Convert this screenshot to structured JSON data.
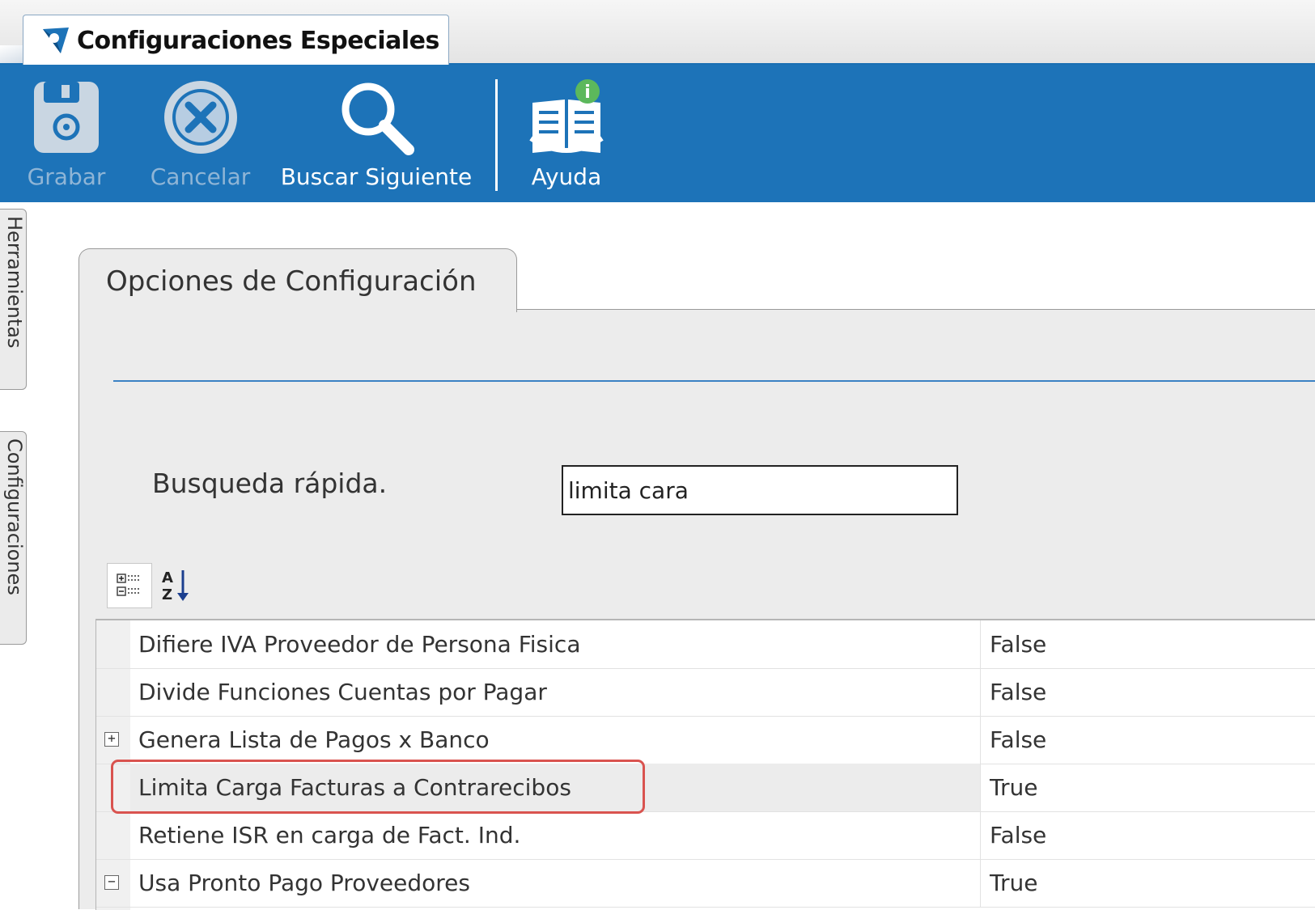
{
  "window": {
    "tab_title": "Configuraciones Especiales"
  },
  "toolbar": {
    "items": [
      {
        "label": "Grabar",
        "icon": "save-icon",
        "enabled": false
      },
      {
        "label": "Cancelar",
        "icon": "cancel-icon",
        "enabled": false
      },
      {
        "label": "Buscar Siguiente",
        "icon": "search-icon",
        "enabled": true
      },
      {
        "label": "Ayuda",
        "icon": "help-book-icon",
        "enabled": true
      }
    ]
  },
  "sidebar": {
    "tabs": [
      {
        "label": "Herramientas"
      },
      {
        "label": "Configuraciones"
      }
    ]
  },
  "panel": {
    "tab_label": "Opciones de Configuración",
    "search_label": "Busqueda rápida.",
    "search_value": "limita cara"
  },
  "grid": {
    "toolbar": [
      {
        "icon": "categorized-view-icon",
        "active": true
      },
      {
        "icon": "sort-alphabetical-icon",
        "active": false
      }
    ],
    "rows": [
      {
        "name": "Difiere IVA Proveedor de Persona Fisica",
        "value": "False",
        "expander": ""
      },
      {
        "name": "Divide Funciones Cuentas por Pagar",
        "value": "False",
        "expander": ""
      },
      {
        "name": "Genera Lista de Pagos x Banco",
        "value": "False",
        "expander": "+"
      },
      {
        "name": "Limita Carga Facturas a Contrarecibos",
        "value": "True",
        "expander": "",
        "selected": true
      },
      {
        "name": "Retiene ISR en carga de Fact. Ind.",
        "value": "False",
        "expander": ""
      },
      {
        "name": "Usa Pronto Pago Proveedores",
        "value": "True",
        "expander": "−"
      }
    ]
  },
  "colors": {
    "toolbar_bg": "#1d73b8",
    "highlight": "#d9534f",
    "panel_bg": "#ececec"
  }
}
